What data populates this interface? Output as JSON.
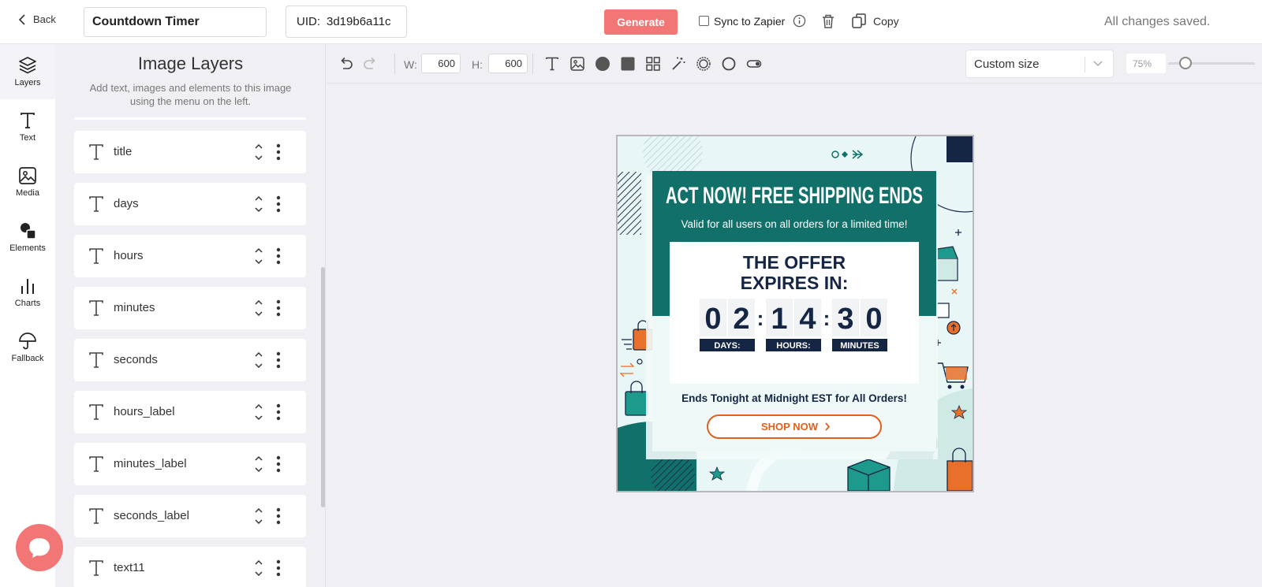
{
  "topbar": {
    "back_label": "Back",
    "design_name": "Countdown Timer",
    "uid_label": "UID:",
    "uid_value": "3d19b6a11c",
    "generate_label": "Generate",
    "sync_label": "Sync to Zapier",
    "copy_label": "Copy",
    "status": "All changes saved."
  },
  "rail": {
    "items": [
      {
        "label": "Layers",
        "icon": "layers-icon"
      },
      {
        "label": "Text",
        "icon": "text-icon"
      },
      {
        "label": "Media",
        "icon": "image-icon"
      },
      {
        "label": "Elements",
        "icon": "shapes-icon"
      },
      {
        "label": "Charts",
        "icon": "bar-chart-icon"
      },
      {
        "label": "Fallback",
        "icon": "umbrella-icon"
      }
    ]
  },
  "panel": {
    "title": "Image Layers",
    "subtitle": "Add text, images and elements to this image using the menu on the left.",
    "layers": [
      "title",
      "days",
      "hours",
      "minutes",
      "seconds",
      "hours_label",
      "minutes_label",
      "seconds_label",
      "text11"
    ]
  },
  "toolbar": {
    "w_label": "W:",
    "width": "600",
    "h_label": "H:",
    "height": "600",
    "size_preset": "Custom size",
    "zoom": "75%",
    "zoom_fraction": 0.2
  },
  "artboard": {
    "headline": "ACT NOW! FREE SHIPPING ENDS",
    "subheadline": "Valid for all users on all orders for a limited time!",
    "offer_line1": "THE OFFER",
    "offer_line2": "EXPIRES IN:",
    "digits": [
      "0",
      "2",
      "1",
      "4",
      "3",
      "0"
    ],
    "colon": ":",
    "labels": [
      "DAYS:",
      "HOURS:",
      "MINUTES"
    ],
    "ends_text": "Ends Tonight at Midnight EST for All Orders!",
    "cta": "SHOP NOW",
    "colors": {
      "teal": "#11706a",
      "navy": "#152644",
      "orange": "#e8702a",
      "mint": "#e6f4f3",
      "generate": "#f27676"
    }
  }
}
